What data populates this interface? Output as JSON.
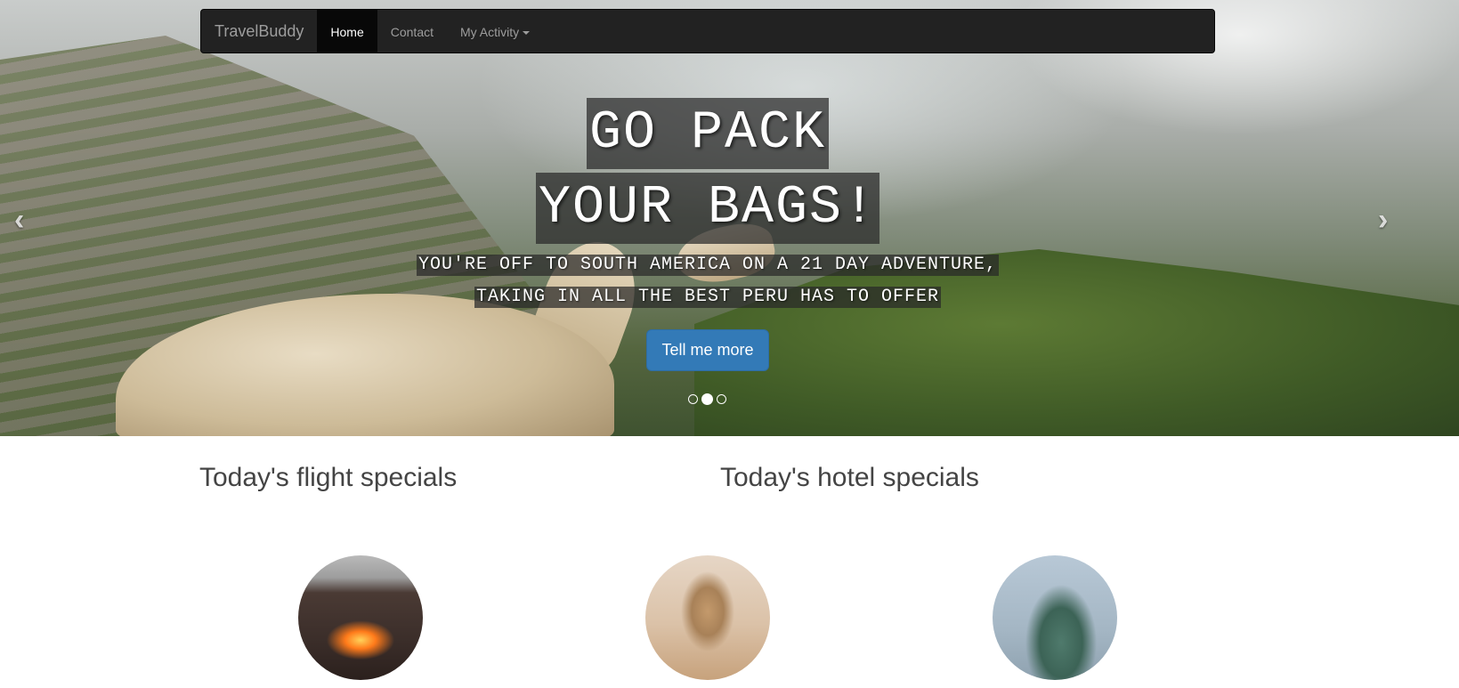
{
  "navbar": {
    "brand": "TravelBuddy",
    "items": [
      {
        "label": "Home",
        "active": true
      },
      {
        "label": "Contact",
        "active": false
      },
      {
        "label": "My Activity",
        "active": false,
        "dropdown": true
      }
    ]
  },
  "hero": {
    "headline_line1": "GO PACK",
    "headline_line2": "YOUR BAGS!",
    "subtitle_line1": "YOU'RE OFF TO SOUTH AMERICA ON A 21 DAY ADVENTURE,",
    "subtitle_line2": "TAKING IN ALL THE BEST PERU HAS TO OFFER",
    "cta_label": "Tell me more",
    "prev_icon": "‹",
    "next_icon": "›",
    "indicators": {
      "count": 3,
      "active_index": 1
    }
  },
  "specials": {
    "flight_heading": "Today's flight specials",
    "hotel_heading": "Today's hotel specials"
  },
  "thumbnails": [
    "volcano-lava-image",
    "sphinx-image",
    "statue-image"
  ],
  "colors": {
    "navbar_bg": "#222222",
    "primary_button": "#337ab7",
    "caption_bg": "rgba(40,40,40,0.72)"
  }
}
